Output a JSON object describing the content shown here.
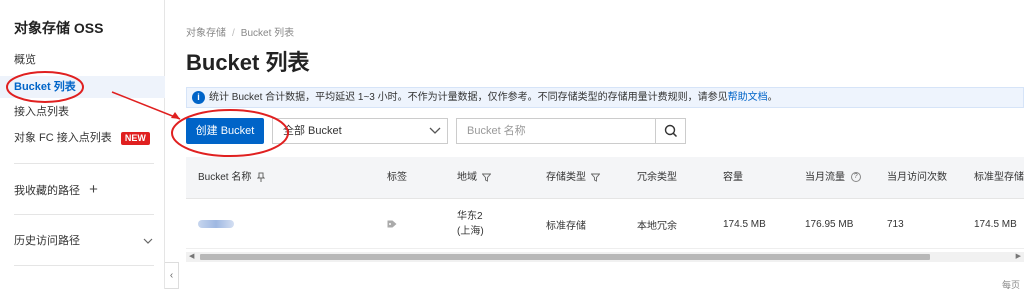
{
  "sidebar": {
    "title": "对象存储 OSS",
    "items": [
      {
        "label": "概览"
      },
      {
        "label": "Bucket 列表"
      },
      {
        "label": "接入点列表"
      },
      {
        "label": "对象 FC 接入点列表",
        "badge": "NEW"
      }
    ],
    "favorites_label": "我收藏的路径",
    "favorites_action": "+",
    "history_label": "历史访问路径",
    "collapse_icon": "chevron-left-icon"
  },
  "breadcrumb": [
    "对象存储",
    "Bucket 列表"
  ],
  "page_title": "Bucket 列表",
  "notice": {
    "text": "统计 Bucket 合计数据，平均延迟 1~3 小时。不作为计量数据，仅作参考。不同存储类型的存储用量计费规则，请参见",
    "link": "帮助文档",
    "suffix": "。"
  },
  "toolbar": {
    "create_label": "创建 Bucket",
    "filter_selected": "全部 Bucket",
    "search_placeholder": "Bucket 名称"
  },
  "table": {
    "columns": [
      "Bucket 名称",
      "标签",
      "地域",
      "存储类型",
      "冗余类型",
      "容量",
      "当月流量",
      "当月访问次数",
      "标准型存储"
    ],
    "row": {
      "region_line1": "华东2",
      "region_line2": "(上海)",
      "storage_type": "标准存储",
      "redundancy": "本地冗余",
      "capacity": "174.5 MB",
      "monthly_traffic": "176.95 MB",
      "monthly_requests": "713",
      "standard_storage": "174.5 MB"
    }
  },
  "footer_text": "每页",
  "colors": {
    "accent": "#0064c8",
    "annotation": "#e02020",
    "new_badge": "#e02020"
  }
}
